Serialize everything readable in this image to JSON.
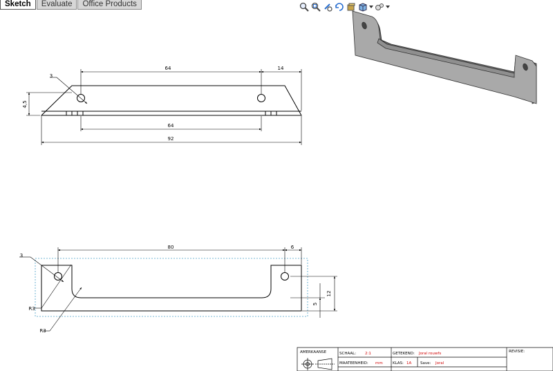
{
  "tabs": [
    "Sketch",
    "Evaluate",
    "Office Products"
  ],
  "toolbar": {
    "icons": [
      "zoom-to-fit-icon",
      "zoom-area-icon",
      "rotate-view-icon",
      "standard-views-icon",
      "display-style-icon",
      "hide-show-icon",
      "view-settings-icon"
    ]
  },
  "drawing": {
    "top_view": {
      "dim_hole_dia": "3",
      "dim_holes": "64",
      "dim_end": "14",
      "dim_height": "4,5",
      "dim_inner": "64",
      "dim_total": "92"
    },
    "front_view": {
      "dim_hole_dia": "3",
      "dim_span": "80",
      "dim_end": "6",
      "dim_radius_top": "R3",
      "dim_radius_bottom": "R3",
      "dim_height_small": "5",
      "dim_height": "12"
    }
  },
  "title_block": {
    "projection_label": "AMERKAANSE",
    "schaal_label": "SCHAAL:",
    "schaal_value": "2:1",
    "getekend_label": "GETEKEND:",
    "getekend_value": "Joral rouwfs",
    "revisie_label": "REVISIE:",
    "maateenheid_label": "MAATEENHEID:",
    "maateenheid_value": "mm",
    "klas_label": "KLAS:",
    "klas_value": "1A",
    "save_label": "Save:",
    "save_value": "Joral"
  },
  "colors": {
    "part_face": "#a9a9a9",
    "part_shadow": "#6e6e6e",
    "dimension_red": "#d00000",
    "bounding_dash": "#4aa0c8"
  }
}
